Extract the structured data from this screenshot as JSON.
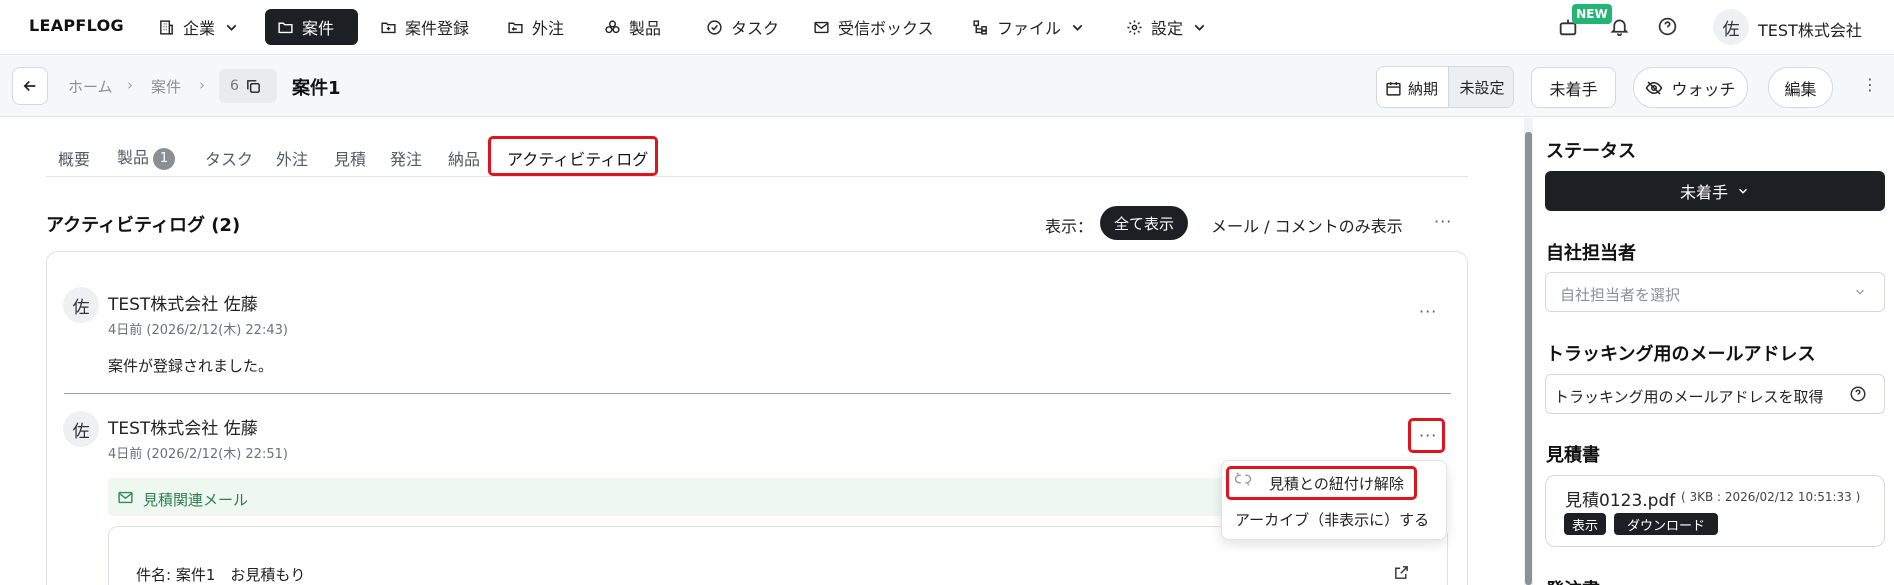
{
  "nav": {
    "logo": "LEAPFLOG",
    "items": [
      {
        "label": "企業",
        "icon": "building-icon"
      },
      {
        "label": "案件",
        "icon": "folder-icon"
      },
      {
        "label": "案件登録",
        "icon": "folder-plus-icon"
      },
      {
        "label": "外注",
        "icon": "outsource-icon"
      },
      {
        "label": "製品",
        "icon": "cubes-icon"
      },
      {
        "label": "タスク",
        "icon": "check-circle-icon"
      },
      {
        "label": "受信ボックス",
        "icon": "mail-icon"
      },
      {
        "label": "ファイル",
        "icon": "file-tree-icon"
      },
      {
        "label": "設定",
        "icon": "gear-icon"
      }
    ],
    "new_badge": "NEW",
    "company_avatar": "佐",
    "company": "TEST株式会社"
  },
  "subheader": {
    "breadcrumb": [
      "ホーム",
      "案件"
    ],
    "case_number": "6",
    "case_title": "案件1",
    "due_label": "納期",
    "due_value": "未設定",
    "status_button": "未着手",
    "watch_button": "ウォッチ",
    "edit_button": "編集"
  },
  "tabs": [
    {
      "label": "概要"
    },
    {
      "label": "製品",
      "count": "1"
    },
    {
      "label": "タスク"
    },
    {
      "label": "外注"
    },
    {
      "label": "見積"
    },
    {
      "label": "発注"
    },
    {
      "label": "納品"
    },
    {
      "label": "アクティビティログ"
    }
  ],
  "activity": {
    "title": "アクティビティログ (2)",
    "filter_label": "表示：",
    "filter_all": "全て表示",
    "filter_mail": "メール / コメントのみ表示",
    "entries": [
      {
        "avatar": "佐",
        "author": "TEST株式会社 佐藤",
        "time": "4日前 (2026/2/12(木) 22:43)",
        "body": "案件が登録されました。"
      },
      {
        "avatar": "佐",
        "author": "TEST株式会社 佐藤",
        "time": "4日前 (2026/2/12(木) 22:51)",
        "mail_tag": "見積関連メール",
        "subject": "件名: 案件1　お見積もり"
      }
    ],
    "menu": {
      "unlink": "見積との紐付け解除",
      "archive": "アーカイブ（非表示に）する"
    }
  },
  "sidebar": {
    "status_title": "ステータス",
    "status_value": "未着手",
    "owner_title": "自社担当者",
    "owner_placeholder": "自社担当者を選択",
    "tracking_title": "トラッキング用のメールアドレス",
    "tracking_button": "トラッキング用のメールアドレスを取得",
    "quote_title": "見積書",
    "quote_file": "見積0123.pdf",
    "quote_meta": "( 3KB : 2026/02/12 10:51:33 )",
    "quote_view": "表示",
    "quote_download": "ダウンロード",
    "next_title": "発注書"
  }
}
